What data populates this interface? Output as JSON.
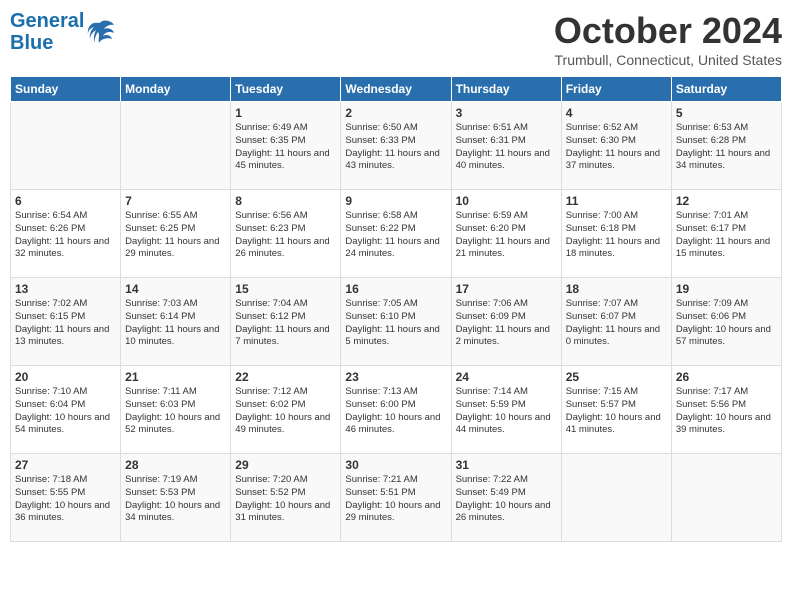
{
  "logo": {
    "text1": "General",
    "text2": "Blue"
  },
  "title": "October 2024",
  "location": "Trumbull, Connecticut, United States",
  "days_of_week": [
    "Sunday",
    "Monday",
    "Tuesday",
    "Wednesday",
    "Thursday",
    "Friday",
    "Saturday"
  ],
  "weeks": [
    [
      {
        "day": "",
        "info": ""
      },
      {
        "day": "",
        "info": ""
      },
      {
        "day": "1",
        "info": "Sunrise: 6:49 AM\nSunset: 6:35 PM\nDaylight: 11 hours and 45 minutes."
      },
      {
        "day": "2",
        "info": "Sunrise: 6:50 AM\nSunset: 6:33 PM\nDaylight: 11 hours and 43 minutes."
      },
      {
        "day": "3",
        "info": "Sunrise: 6:51 AM\nSunset: 6:31 PM\nDaylight: 11 hours and 40 minutes."
      },
      {
        "day": "4",
        "info": "Sunrise: 6:52 AM\nSunset: 6:30 PM\nDaylight: 11 hours and 37 minutes."
      },
      {
        "day": "5",
        "info": "Sunrise: 6:53 AM\nSunset: 6:28 PM\nDaylight: 11 hours and 34 minutes."
      }
    ],
    [
      {
        "day": "6",
        "info": "Sunrise: 6:54 AM\nSunset: 6:26 PM\nDaylight: 11 hours and 32 minutes."
      },
      {
        "day": "7",
        "info": "Sunrise: 6:55 AM\nSunset: 6:25 PM\nDaylight: 11 hours and 29 minutes."
      },
      {
        "day": "8",
        "info": "Sunrise: 6:56 AM\nSunset: 6:23 PM\nDaylight: 11 hours and 26 minutes."
      },
      {
        "day": "9",
        "info": "Sunrise: 6:58 AM\nSunset: 6:22 PM\nDaylight: 11 hours and 24 minutes."
      },
      {
        "day": "10",
        "info": "Sunrise: 6:59 AM\nSunset: 6:20 PM\nDaylight: 11 hours and 21 minutes."
      },
      {
        "day": "11",
        "info": "Sunrise: 7:00 AM\nSunset: 6:18 PM\nDaylight: 11 hours and 18 minutes."
      },
      {
        "day": "12",
        "info": "Sunrise: 7:01 AM\nSunset: 6:17 PM\nDaylight: 11 hours and 15 minutes."
      }
    ],
    [
      {
        "day": "13",
        "info": "Sunrise: 7:02 AM\nSunset: 6:15 PM\nDaylight: 11 hours and 13 minutes."
      },
      {
        "day": "14",
        "info": "Sunrise: 7:03 AM\nSunset: 6:14 PM\nDaylight: 11 hours and 10 minutes."
      },
      {
        "day": "15",
        "info": "Sunrise: 7:04 AM\nSunset: 6:12 PM\nDaylight: 11 hours and 7 minutes."
      },
      {
        "day": "16",
        "info": "Sunrise: 7:05 AM\nSunset: 6:10 PM\nDaylight: 11 hours and 5 minutes."
      },
      {
        "day": "17",
        "info": "Sunrise: 7:06 AM\nSunset: 6:09 PM\nDaylight: 11 hours and 2 minutes."
      },
      {
        "day": "18",
        "info": "Sunrise: 7:07 AM\nSunset: 6:07 PM\nDaylight: 11 hours and 0 minutes."
      },
      {
        "day": "19",
        "info": "Sunrise: 7:09 AM\nSunset: 6:06 PM\nDaylight: 10 hours and 57 minutes."
      }
    ],
    [
      {
        "day": "20",
        "info": "Sunrise: 7:10 AM\nSunset: 6:04 PM\nDaylight: 10 hours and 54 minutes."
      },
      {
        "day": "21",
        "info": "Sunrise: 7:11 AM\nSunset: 6:03 PM\nDaylight: 10 hours and 52 minutes."
      },
      {
        "day": "22",
        "info": "Sunrise: 7:12 AM\nSunset: 6:02 PM\nDaylight: 10 hours and 49 minutes."
      },
      {
        "day": "23",
        "info": "Sunrise: 7:13 AM\nSunset: 6:00 PM\nDaylight: 10 hours and 46 minutes."
      },
      {
        "day": "24",
        "info": "Sunrise: 7:14 AM\nSunset: 5:59 PM\nDaylight: 10 hours and 44 minutes."
      },
      {
        "day": "25",
        "info": "Sunrise: 7:15 AM\nSunset: 5:57 PM\nDaylight: 10 hours and 41 minutes."
      },
      {
        "day": "26",
        "info": "Sunrise: 7:17 AM\nSunset: 5:56 PM\nDaylight: 10 hours and 39 minutes."
      }
    ],
    [
      {
        "day": "27",
        "info": "Sunrise: 7:18 AM\nSunset: 5:55 PM\nDaylight: 10 hours and 36 minutes."
      },
      {
        "day": "28",
        "info": "Sunrise: 7:19 AM\nSunset: 5:53 PM\nDaylight: 10 hours and 34 minutes."
      },
      {
        "day": "29",
        "info": "Sunrise: 7:20 AM\nSunset: 5:52 PM\nDaylight: 10 hours and 31 minutes."
      },
      {
        "day": "30",
        "info": "Sunrise: 7:21 AM\nSunset: 5:51 PM\nDaylight: 10 hours and 29 minutes."
      },
      {
        "day": "31",
        "info": "Sunrise: 7:22 AM\nSunset: 5:49 PM\nDaylight: 10 hours and 26 minutes."
      },
      {
        "day": "",
        "info": ""
      },
      {
        "day": "",
        "info": ""
      }
    ]
  ]
}
